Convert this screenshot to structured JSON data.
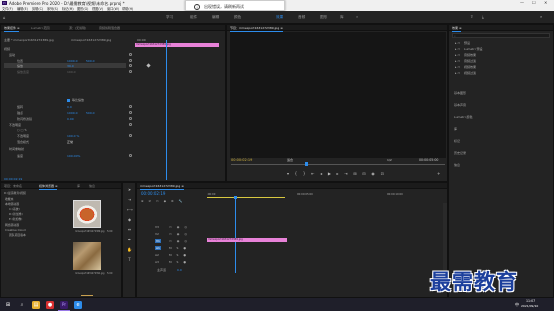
{
  "titlebar": {
    "app_icon": "Pr",
    "title": "Adobe Premiere Pro 2020 - D:\\最需教育\\视频\\未命名.prproj *",
    "controls": [
      "—",
      "☐",
      "✕"
    ]
  },
  "menubar": {
    "items": [
      "文件(F)",
      "编辑(E)",
      "剪辑(C)",
      "序列(S)",
      "标记(M)",
      "图形(G)",
      "视图(V)",
      "窗口(W)",
      "帮助(H)"
    ]
  },
  "toast": {
    "icon": "i",
    "text": "出现错误，请刷新再试"
  },
  "workspaces": {
    "items": [
      "学习",
      "组件",
      "编辑",
      "颜色",
      "效果",
      "音频",
      "图形",
      "库"
    ],
    "active_index": 4,
    "overflow": "»"
  },
  "effect_controls": {
    "tabs": [
      "效果控件 ≡",
      "Lumetri 范围",
      "源：(无剪辑)",
      "音频剪辑混合器"
    ],
    "master": "主要 * mmexport1631272389.jpg",
    "sequence": "mmexport1631272389.jpg",
    "clip_label": "mmexport1631272389.jpg",
    "timecode": "00:00",
    "video_header": "视频",
    "motion": "运动",
    "position_label": "位置",
    "position_x": "1000.0",
    "position_y": "500.0",
    "scale_label": "缩放",
    "scale_value": "39.0",
    "scale_width_label": "缩放宽度",
    "scale_width_value": "100.0",
    "uniform_label": "等比缩放",
    "rotation_label": "旋转",
    "rotation_value": "0.0",
    "anchor_label": "锚点",
    "anchor_x": "1000.0",
    "anchor_y": "500.0",
    "flicker_label": "防闪烁滤镜",
    "flicker_value": "0.00",
    "opacity_header": "不透明度",
    "opacity_label": "不透明度",
    "opacity_value": "100.0 %",
    "blend_label": "混合模式",
    "blend_value": "正常",
    "time_remap": "时间重映射",
    "speed_label": "速度",
    "speed_value": "100.00%"
  },
  "program": {
    "tab": "节目：mmexport1631272389.jpg ≡",
    "timecode": "00:00:02:19",
    "fit": "适合",
    "fraction": "1/2",
    "duration": "00:00:05:00"
  },
  "right_panel": {
    "tabs": [
      "效果 ≡"
    ],
    "search_placeholder": "",
    "items": [
      "预设",
      "Lumetri 预设",
      "音频效果",
      "音频过渡",
      "视频效果",
      "视频过渡"
    ],
    "sections": [
      "基本图形",
      "基本声音",
      "Lumetri 颜色",
      "库",
      "标记",
      "历史记录",
      "信息"
    ]
  },
  "project": {
    "tabs": [
      "项目：未命名",
      "媒体浏览器 ≡",
      "库",
      "信息"
    ],
    "path": "D:\\最需教育\\视频",
    "tree": [
      "收藏夹",
      "本地驱动器",
      "C:(系统)",
      "D:(新加卷)",
      "E:(新加卷)",
      "网络驱动器",
      "Creative Cloud",
      "团队项目版本"
    ],
    "thumb1_name": "mmexport1631272389.jpg",
    "thumb1_dur": "5:00",
    "thumb2_name": "mmexport1631272391.jpg",
    "thumb2_dur": "5:00"
  },
  "timeline": {
    "tab": "mmexport1631272389.jpg ≡",
    "timecode": "00:00:02:19",
    "tracks": [
      "V3",
      "V2",
      "V1",
      "A1",
      "A2",
      "A3"
    ],
    "master": "主声道",
    "master_value": "0.0",
    "clip": "mmexport1631272389.jpg",
    "ruler_marks": [
      ":00:00",
      "00:00:05:00",
      "00:00:10:00"
    ]
  },
  "taskbar": {
    "time": "11:07",
    "date": "2021/09/10",
    "lang": "中"
  },
  "watermark": "最需教育"
}
